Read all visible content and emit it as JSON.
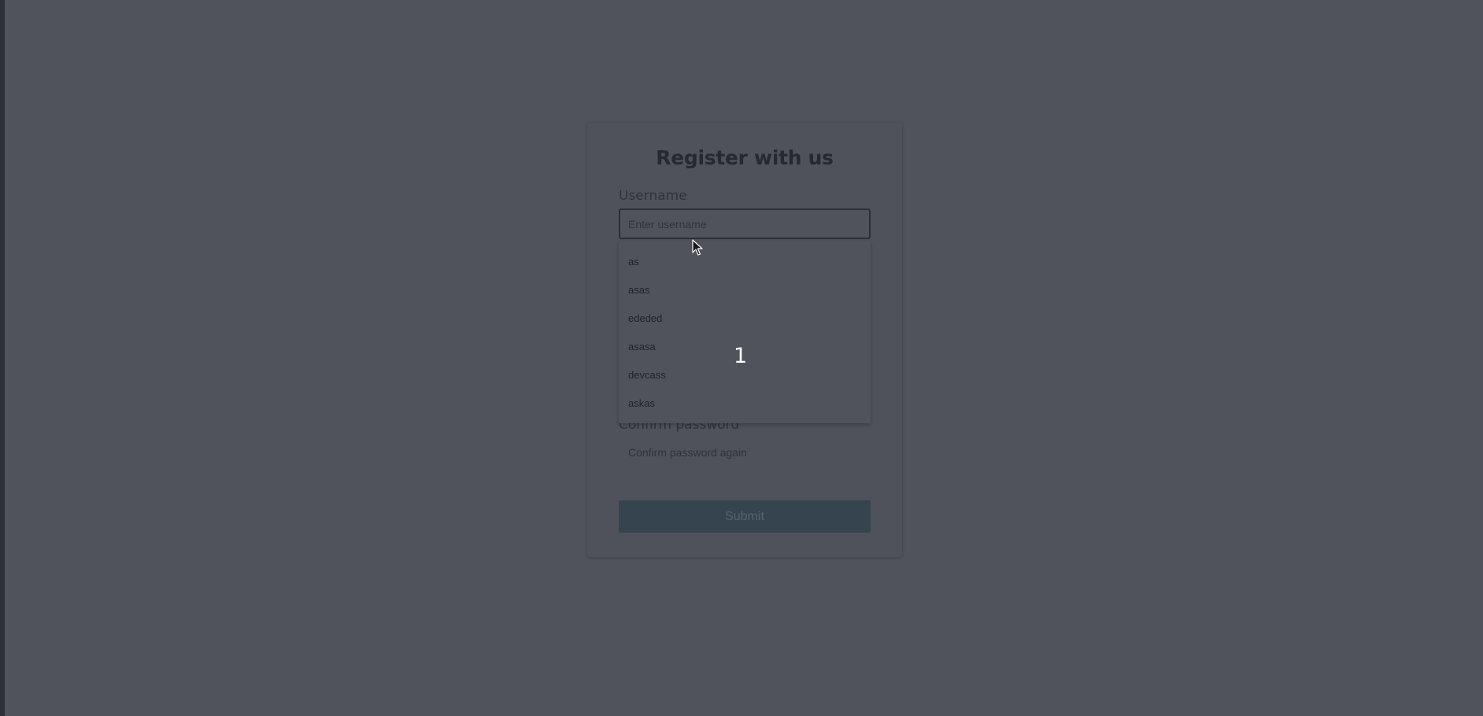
{
  "form": {
    "title": "Register with us",
    "username_label": "Username",
    "username_placeholder": "Enter username",
    "username_value": "",
    "confirm_label": "Confirm password",
    "confirm_placeholder": "Confirm password again",
    "confirm_value": "",
    "submit_label": "Submit"
  },
  "autocomplete": {
    "items": [
      "as",
      "asas",
      "ededed",
      "asasa",
      "devcass",
      "askas"
    ]
  },
  "overlay": {
    "badge": "1"
  },
  "colors": {
    "background": "#50535c",
    "submit_button": "#35444f"
  },
  "icons": {
    "cursor": "mouse-pointer-icon"
  }
}
